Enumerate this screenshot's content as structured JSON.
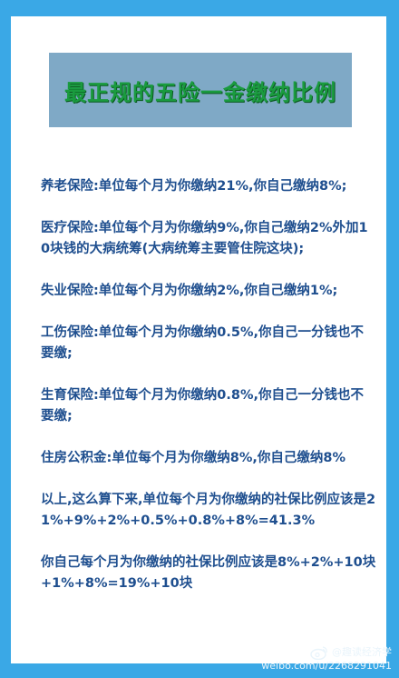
{
  "title": "最正规的五险一金缴纳比例",
  "items": [
    "养老保险:单位每个月为你缴纳21%,你自己缴纳8%;",
    "医疗保险:单位每个月为你缴纳9%,你自己缴纳2%外加10块钱的大病统筹(大病统筹主要管住院这块);",
    "失业保险:单位每个月为你缴纳2%,你自己缴纳1%;",
    "工伤保险:单位每个月为你缴纳0.5%,你自己一分钱也不要缴;",
    "生育保险:单位每个月为你缴纳0.8%,你自己一分钱也不要缴;",
    "住房公积金:单位每个月为你缴纳8%,你自己缴纳8%",
    "以上,这么算下来,单位每个月为你缴纳的社保比例应该是21%+9%+2%+0.5%+0.8%+8%=41.3%",
    "你自己每个月为你缴纳的社保比例应该是8%+2%+10块+1%+8%=19%+10块"
  ],
  "watermark": {
    "handle": "@趣读经济学",
    "url": "weibo.com/u/2268291041"
  },
  "colors": {
    "background": "#3aa8e6",
    "title_banner": "#7fa9c6",
    "title_text": "#1a9b3f",
    "body_text": "#1f4f8f"
  },
  "icons": {
    "watermark_logo": "weibo-icon"
  }
}
